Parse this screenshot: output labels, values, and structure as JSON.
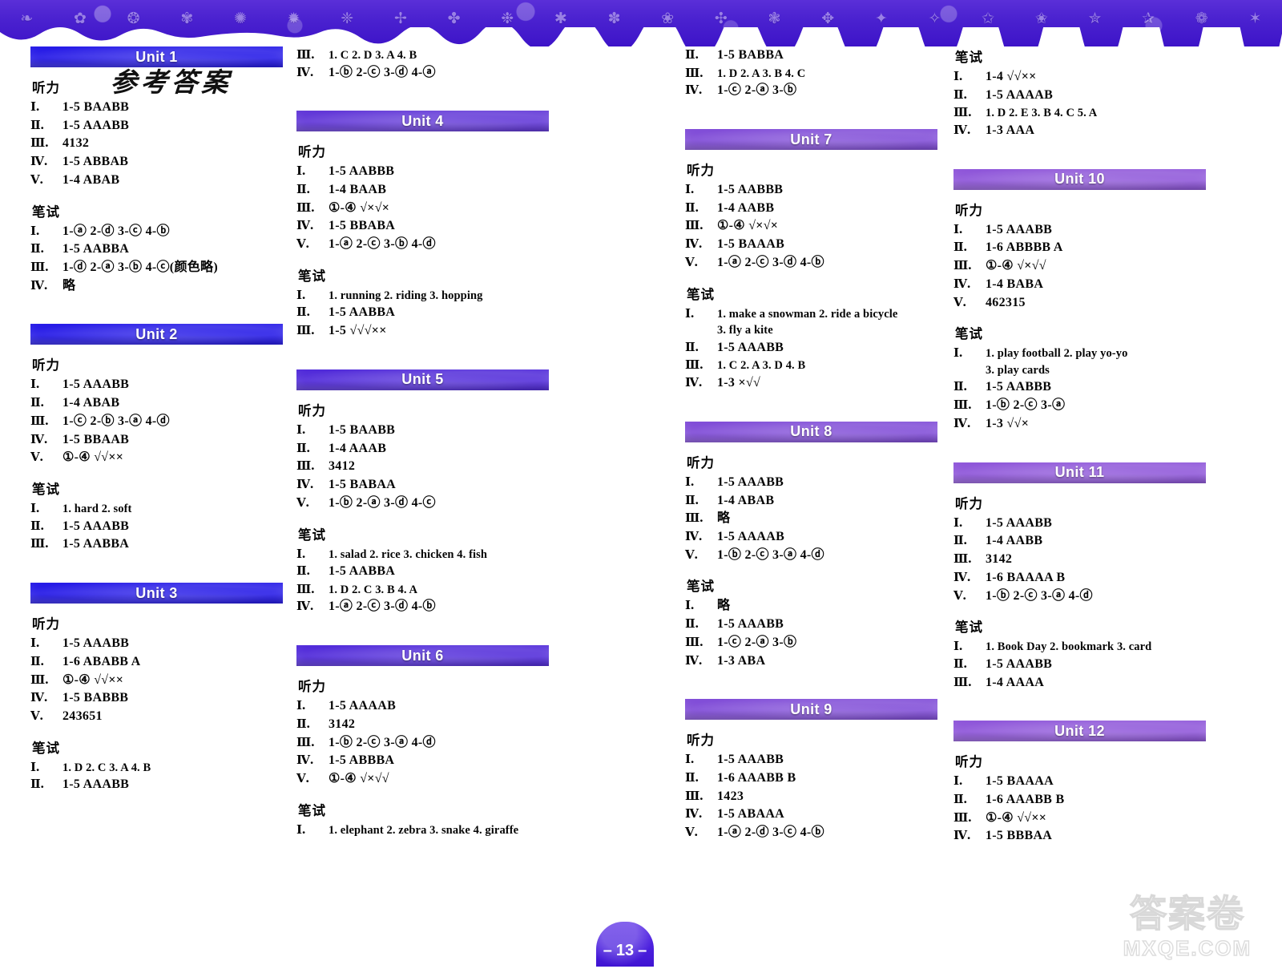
{
  "page": {
    "title_cn": "参考答案",
    "page_number": "13",
    "watermark_cn": "答案卷",
    "watermark_en": "MXQE.COM"
  },
  "labels": {
    "listening": "听力",
    "written": "笔试",
    "r1": "Ⅰ.",
    "r2": "Ⅱ.",
    "r3": "Ⅲ.",
    "r4": "Ⅳ.",
    "r5": "Ⅴ."
  },
  "decor": {
    "band_color": "#4a22d2",
    "banner_color_unit1": "#1a12e0",
    "banner_color_unit12": "#7a42d8",
    "glyphs": [
      "❧",
      "✿",
      "❂",
      "✾",
      "✺",
      "✹",
      "❈",
      "✢",
      "✤",
      "❉",
      "✱",
      "✽",
      "❀",
      "✣",
      "❃",
      "✥",
      "✦",
      "✧",
      "✩",
      "✬",
      "✮",
      "✰",
      "❁",
      "✶"
    ]
  },
  "columns": [
    {
      "name": "column-1",
      "top_continuation": [],
      "units": [
        {
          "title": "Unit 1",
          "banner_color": "#1c10e6",
          "sections": [
            {
              "heading": "听力",
              "rows": [
                {
                  "num": "Ⅰ.",
                  "value": "1-5  BAABB"
                },
                {
                  "num": "Ⅱ.",
                  "value": "1-5  AAABB"
                },
                {
                  "num": "Ⅲ.",
                  "value": "4132"
                },
                {
                  "num": "Ⅳ.",
                  "value": "1-5  ABBAB"
                },
                {
                  "num": "Ⅴ.",
                  "value": "1-4  ABAB"
                }
              ]
            },
            {
              "heading": "笔试",
              "rows": [
                {
                  "num": "Ⅰ.",
                  "value": "1-ⓐ  2-ⓓ  3-ⓒ  4-ⓑ"
                },
                {
                  "num": "Ⅱ.",
                  "value": "1-5  AABBA"
                },
                {
                  "num": "Ⅲ.",
                  "value": "1-ⓓ  2-ⓐ  3-ⓑ  4-ⓒ(颜色略)"
                },
                {
                  "num": "Ⅳ.",
                  "value": "略"
                }
              ]
            }
          ]
        },
        {
          "title": "Unit 2",
          "banner_color": "#1c10e6",
          "sections": [
            {
              "heading": "听力",
              "rows": [
                {
                  "num": "Ⅰ.",
                  "value": "1-5  AAABB"
                },
                {
                  "num": "Ⅱ.",
                  "value": "1-4  ABAB"
                },
                {
                  "num": "Ⅲ.",
                  "value": "1-ⓒ  2-ⓑ  3-ⓐ  4-ⓓ"
                },
                {
                  "num": "Ⅳ.",
                  "value": "1-5  BBAAB"
                },
                {
                  "num": "Ⅴ.",
                  "value": "①-④  √√××"
                }
              ]
            },
            {
              "heading": "笔试",
              "rows": [
                {
                  "num": "Ⅰ.",
                  "value": "1. hard   2. soft",
                  "small": true
                },
                {
                  "num": "Ⅱ.",
                  "value": "1-5  AAABB"
                },
                {
                  "num": "Ⅲ.",
                  "value": "1-5  AABBA"
                }
              ]
            }
          ]
        },
        {
          "title": "Unit 3",
          "banner_color": "#1c10e6",
          "sections": [
            {
              "heading": "听力",
              "rows": [
                {
                  "num": "Ⅰ.",
                  "value": "1-5  AAABB"
                },
                {
                  "num": "Ⅱ.",
                  "value": "1-6  ABABB  A"
                },
                {
                  "num": "Ⅲ.",
                  "value": "①-④  √√××"
                },
                {
                  "num": "Ⅳ.",
                  "value": "1-5  BABBB"
                },
                {
                  "num": "Ⅴ.",
                  "value": "243651"
                }
              ]
            },
            {
              "heading": "笔试",
              "rows": [
                {
                  "num": "Ⅰ.",
                  "value": "1. D  2. C  3. A   4. B",
                  "small": true
                },
                {
                  "num": "Ⅱ.",
                  "value": "1-5  AAABB"
                }
              ]
            }
          ]
        }
      ]
    },
    {
      "name": "column-2",
      "top_continuation": [
        {
          "num": "Ⅲ.",
          "value": "1. C  2. D  3. A   4. B",
          "small": true
        },
        {
          "num": "Ⅳ.",
          "value": "1-ⓑ  2-ⓒ  3-ⓓ  4-ⓐ"
        }
      ],
      "units": [
        {
          "title": "Unit 4",
          "banner_color": "#5b2fd6",
          "sections": [
            {
              "heading": "听力",
              "rows": [
                {
                  "num": "Ⅰ.",
                  "value": "1-5  AABBB"
                },
                {
                  "num": "Ⅱ.",
                  "value": "1-4  BAAB"
                },
                {
                  "num": "Ⅲ.",
                  "value": "①-④  √×√×"
                },
                {
                  "num": "Ⅳ.",
                  "value": "1-5  BBABA"
                },
                {
                  "num": "Ⅴ.",
                  "value": "1-ⓐ  2-ⓒ  3-ⓑ   4-ⓓ"
                }
              ]
            },
            {
              "heading": "笔试",
              "rows": [
                {
                  "num": "Ⅰ.",
                  "value": "1. running  2. riding   3. hopping",
                  "small": true
                },
                {
                  "num": "Ⅱ.",
                  "value": "1-5  AABBA"
                },
                {
                  "num": "Ⅲ.",
                  "value": "1-5  √√√××"
                }
              ]
            }
          ]
        },
        {
          "title": "Unit 5",
          "banner_color": "#4a22d8",
          "sections": [
            {
              "heading": "听力",
              "rows": [
                {
                  "num": "Ⅰ.",
                  "value": "1-5  BAABB"
                },
                {
                  "num": "Ⅱ.",
                  "value": "1-4  AAAB"
                },
                {
                  "num": "Ⅲ.",
                  "value": "3412"
                },
                {
                  "num": "Ⅳ.",
                  "value": "1-5  BABAA"
                },
                {
                  "num": "Ⅴ.",
                  "value": "1-ⓑ  2-ⓐ  3-ⓓ  4-ⓒ"
                }
              ]
            },
            {
              "heading": "笔试",
              "rows": [
                {
                  "num": "Ⅰ.",
                  "value": "1. salad  2. rice  3. chicken  4. fish",
                  "small": true
                },
                {
                  "num": "Ⅱ.",
                  "value": "1-5  AABBA"
                },
                {
                  "num": "Ⅲ.",
                  "value": "1. D  2. C  3. B  4. A",
                  "small": true
                },
                {
                  "num": "Ⅳ.",
                  "value": "1-ⓐ  2-ⓒ  3-ⓓ  4-ⓑ"
                }
              ]
            }
          ]
        },
        {
          "title": "Unit 6",
          "banner_color": "#4a22d8",
          "sections": [
            {
              "heading": "听力",
              "rows": [
                {
                  "num": "Ⅰ.",
                  "value": "1-5  AAAAB"
                },
                {
                  "num": "Ⅱ.",
                  "value": "3142"
                },
                {
                  "num": "Ⅲ.",
                  "value": "1-ⓑ  2-ⓒ  3-ⓐ  4-ⓓ"
                },
                {
                  "num": "Ⅳ.",
                  "value": "1-5  ABBBA"
                },
                {
                  "num": "Ⅴ.",
                  "value": "①-④  √×√√"
                }
              ]
            },
            {
              "heading": "笔试",
              "rows": [
                {
                  "num": "Ⅰ.",
                  "value": "1. elephant  2. zebra  3. snake  4. giraffe",
                  "small": true
                }
              ]
            }
          ]
        }
      ]
    },
    {
      "name": "column-3",
      "top_continuation": [
        {
          "num": "Ⅱ.",
          "value": "1-5  BABBA"
        },
        {
          "num": "Ⅲ.",
          "value": "1. D   2. A   3. B   4. C",
          "small": true
        },
        {
          "num": "Ⅳ.",
          "value": "1-ⓒ  2-ⓐ  3-ⓑ"
        }
      ],
      "units": [
        {
          "title": "Unit 7",
          "banner_color": "#7b45d6",
          "sections": [
            {
              "heading": "听力",
              "rows": [
                {
                  "num": "Ⅰ.",
                  "value": "1-5  AABBB"
                },
                {
                  "num": "Ⅱ.",
                  "value": "1-4  AABB"
                },
                {
                  "num": "Ⅲ.",
                  "value": "①-④  √×√×"
                },
                {
                  "num": "Ⅳ.",
                  "value": "1-5  BAAAB"
                },
                {
                  "num": "Ⅴ.",
                  "value": "1-ⓐ  2-ⓒ  3-ⓓ  4-ⓑ"
                }
              ]
            },
            {
              "heading": "笔试",
              "rows": [
                {
                  "num": "Ⅰ.",
                  "value": "1. make a snowman    2. ride a bicycle",
                  "small": true
                },
                {
                  "num": "",
                  "value": "3. fly a kite",
                  "small": true,
                  "cont": true
                },
                {
                  "num": "Ⅱ.",
                  "value": "1-5  AAABB"
                },
                {
                  "num": "Ⅲ.",
                  "value": "1. C   2. A   3. D   4. B",
                  "small": true
                },
                {
                  "num": "Ⅳ.",
                  "value": "1-3  ×√√"
                }
              ]
            }
          ]
        },
        {
          "title": "Unit 8",
          "banner_color": "#7b45d6",
          "sections": [
            {
              "heading": "听力",
              "rows": [
                {
                  "num": "Ⅰ.",
                  "value": "1-5  AAABB"
                },
                {
                  "num": "Ⅱ.",
                  "value": "1-4  ABAB"
                },
                {
                  "num": "Ⅲ.",
                  "value": "略"
                },
                {
                  "num": "Ⅳ.",
                  "value": "1-5  AAAAB"
                },
                {
                  "num": "Ⅴ.",
                  "value": "1-ⓑ  2-ⓒ  3-ⓐ  4-ⓓ"
                }
              ]
            },
            {
              "heading": "笔试",
              "rows": [
                {
                  "num": "Ⅰ.",
                  "value": "略"
                },
                {
                  "num": "Ⅱ.",
                  "value": "1-5  AAABB"
                },
                {
                  "num": "Ⅲ.",
                  "value": "1-ⓒ  2-ⓐ  3-ⓑ"
                },
                {
                  "num": "Ⅳ.",
                  "value": "1-3  ABA"
                }
              ]
            }
          ]
        },
        {
          "title": "Unit 9",
          "banner_color": "#7b45d6",
          "sections": [
            {
              "heading": "听力",
              "rows": [
                {
                  "num": "Ⅰ.",
                  "value": "1-5  AAABB"
                },
                {
                  "num": "Ⅱ.",
                  "value": "1-6  AAABB  B"
                },
                {
                  "num": "Ⅲ.",
                  "value": "1423"
                },
                {
                  "num": "Ⅳ.",
                  "value": "1-5  ABAAA"
                },
                {
                  "num": "Ⅴ.",
                  "value": "1-ⓐ  2-ⓓ  3-ⓒ  4-ⓑ"
                }
              ]
            }
          ]
        }
      ]
    },
    {
      "name": "column-4",
      "top_continuation": [],
      "top_section": {
        "heading": "笔试",
        "rows": [
          {
            "num": "Ⅰ.",
            "value": "1-4  √√××"
          },
          {
            "num": "Ⅱ.",
            "value": "1-5  AAAAB"
          },
          {
            "num": "Ⅲ.",
            "value": "1. D  2. E  3. B  4. C  5. A",
            "small": true
          },
          {
            "num": "Ⅳ.",
            "value": "1-3  AAA"
          }
        ]
      },
      "units": [
        {
          "title": "Unit 10",
          "banner_color": "#8a4fd8",
          "sections": [
            {
              "heading": "听力",
              "rows": [
                {
                  "num": "Ⅰ.",
                  "value": "1-5  AAABB"
                },
                {
                  "num": "Ⅱ.",
                  "value": "1-6  ABBBB  A"
                },
                {
                  "num": "Ⅲ.",
                  "value": "①-④  √×√√"
                },
                {
                  "num": "Ⅳ.",
                  "value": "1-4  BABA"
                },
                {
                  "num": "Ⅴ.",
                  "value": "462315"
                }
              ]
            },
            {
              "heading": "笔试",
              "rows": [
                {
                  "num": "Ⅰ.",
                  "value": "1. play football  2. play yo-yo",
                  "small": true
                },
                {
                  "num": "",
                  "value": "3. play cards",
                  "small": true,
                  "cont": true
                },
                {
                  "num": "Ⅱ.",
                  "value": "1-5  AABBB"
                },
                {
                  "num": "Ⅲ.",
                  "value": "1-ⓑ  2-ⓒ  3-ⓐ"
                },
                {
                  "num": "Ⅳ.",
                  "value": "1-3  √√×"
                }
              ]
            }
          ]
        },
        {
          "title": "Unit 11",
          "banner_color": "#8a4fd8",
          "sections": [
            {
              "heading": "听力",
              "rows": [
                {
                  "num": "Ⅰ.",
                  "value": "1-5  AAABB"
                },
                {
                  "num": "Ⅱ.",
                  "value": "1-4  AABB"
                },
                {
                  "num": "Ⅲ.",
                  "value": "3142"
                },
                {
                  "num": "Ⅳ.",
                  "value": "1-6  BAAAA  B"
                },
                {
                  "num": "Ⅴ.",
                  "value": "1-ⓑ  2-ⓒ  3-ⓐ  4-ⓓ"
                }
              ]
            },
            {
              "heading": "笔试",
              "rows": [
                {
                  "num": "Ⅰ.",
                  "value": "1. Book Day   2. bookmark   3. card",
                  "small": true
                },
                {
                  "num": "Ⅱ.",
                  "value": "1-5  AAABB"
                },
                {
                  "num": "Ⅲ.",
                  "value": "1-4  AAAA"
                }
              ]
            }
          ]
        },
        {
          "title": "Unit 12",
          "banner_color": "#8a4fd8",
          "sections": [
            {
              "heading": "听力",
              "rows": [
                {
                  "num": "Ⅰ.",
                  "value": "1-5  BAAAA"
                },
                {
                  "num": "Ⅱ.",
                  "value": "1-6  AAABB  B"
                },
                {
                  "num": "Ⅲ.",
                  "value": "①-④  √√××"
                },
                {
                  "num": "Ⅳ.",
                  "value": "1-5  BBBAA"
                }
              ]
            }
          ]
        }
      ]
    }
  ]
}
